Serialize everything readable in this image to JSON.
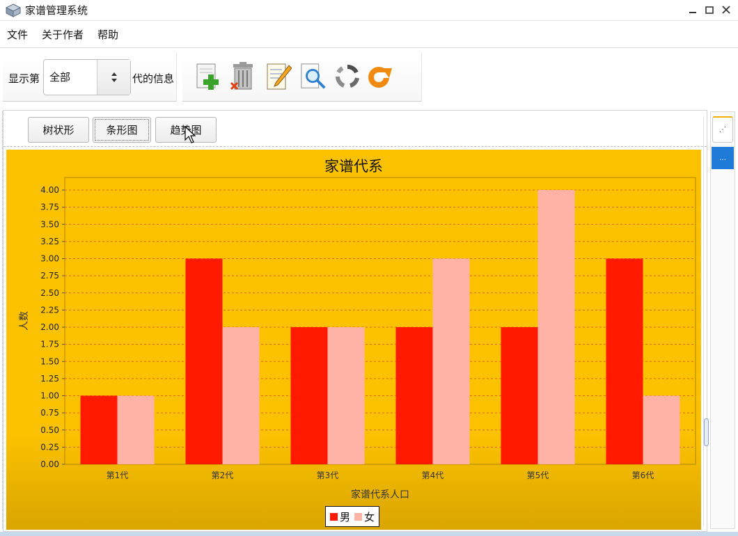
{
  "window": {
    "title": "家谱管理系统"
  },
  "menu": [
    "文件",
    "关于作者",
    "帮助"
  ],
  "toolbar": {
    "generation_prefix": "显示第",
    "generation_value": "全部",
    "generation_suffix": "代的信息",
    "tools": [
      "add-icon",
      "delete-icon",
      "edit-icon",
      "search-icon",
      "recycle-icon",
      "refresh-icon"
    ]
  },
  "tabs": [
    "树状形",
    "条形图",
    "趋势图"
  ],
  "colors": {
    "male": "#ff1a00",
    "female": "#ffb3a7",
    "panel": "#fcc200"
  },
  "chart_data": {
    "type": "bar",
    "title": "家谱代系",
    "xlabel": "家谱代系人口",
    "ylabel": "人数",
    "categories": [
      "第1代",
      "第2代",
      "第3代",
      "第4代",
      "第5代",
      "第6代"
    ],
    "series": [
      {
        "name": "男",
        "values": [
          1,
          3,
          2,
          2,
          2,
          3
        ]
      },
      {
        "name": "女",
        "values": [
          1,
          2,
          2,
          3,
          4,
          1
        ]
      }
    ],
    "ylim": [
      0,
      4
    ],
    "yticks": [
      "0.00",
      "0.25",
      "0.50",
      "0.75",
      "1.00",
      "1.25",
      "1.50",
      "1.75",
      "2.00",
      "2.25",
      "2.50",
      "2.75",
      "3.00",
      "3.25",
      "3.50",
      "3.75",
      "4.00"
    ],
    "grid": true,
    "legend": "bottom-center"
  }
}
